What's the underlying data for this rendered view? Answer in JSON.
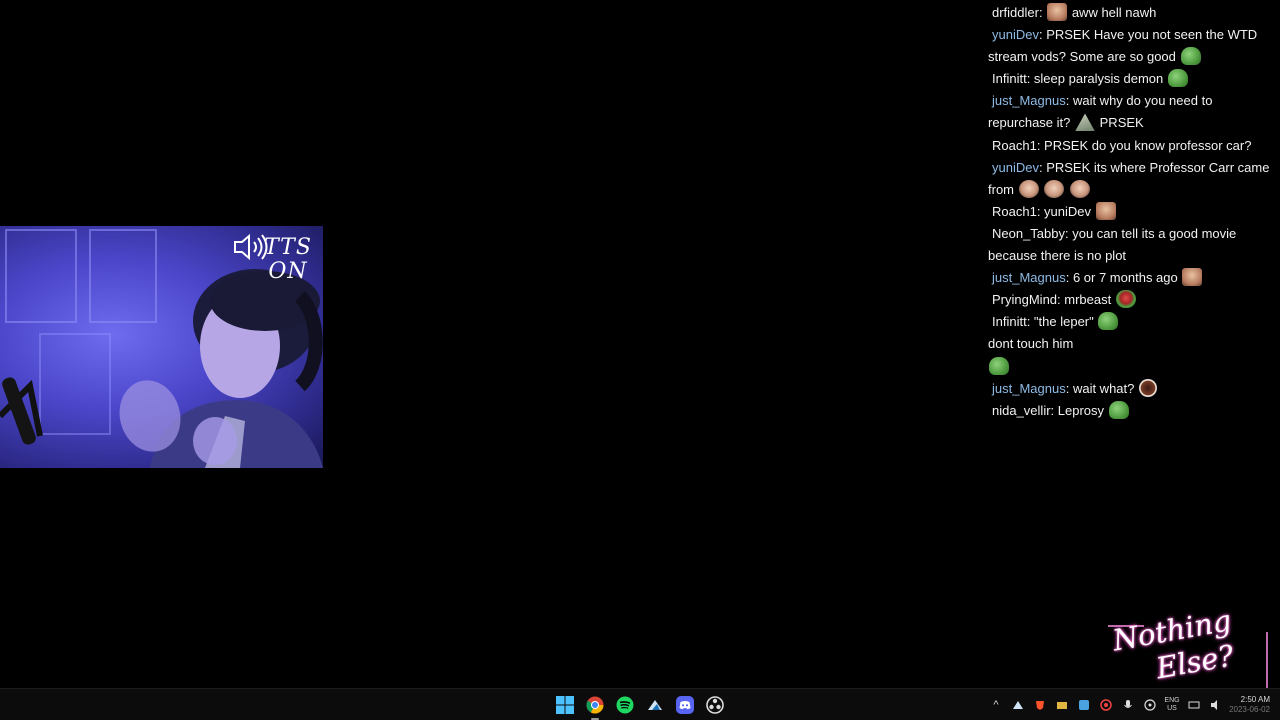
{
  "overlay": {
    "tts_line1": "TTS",
    "tts_line2": "ON",
    "logo_line1": "Nothing",
    "logo_line2": "Else?"
  },
  "chat": {
    "messages": [
      {
        "user": "drfiddler",
        "text": "aww hell nawh"
      },
      {
        "user": "yuniDev",
        "text": "PRSEK Have you not seen the WTD stream vods? Some are so good"
      },
      {
        "user": "Infinitt",
        "text": "sleep paralysis demon"
      },
      {
        "user": "just_Magnus",
        "text": "wait why do you need to repurchase it?",
        "text2": "PRSEK"
      },
      {
        "user": "Roach1",
        "text": "PRSEK do you know professor car?"
      },
      {
        "user": "yuniDev",
        "text": "PRSEK its where Professor Carr came from"
      },
      {
        "user": "Roach1",
        "text": "yuniDev"
      },
      {
        "user": "Neon_Tabby",
        "text": "you can tell its a good movie because there is no plot"
      },
      {
        "user": "just_Magnus",
        "text": "6 or 7 months ago"
      },
      {
        "user": "PryingMind",
        "text": "mrbeast"
      },
      {
        "user": "Infinitt",
        "text": "\"the leper\""
      },
      {
        "user": "",
        "text": "dont touch him"
      },
      {
        "user": "just_Magnus",
        "text": "wait what?"
      },
      {
        "user": "nida_vellir",
        "text": "Leprosy"
      }
    ]
  },
  "taskbar": {
    "apps": [
      {
        "name": "Start",
        "icon": "windows-icon"
      },
      {
        "name": "Chrome",
        "icon": "chrome-icon"
      },
      {
        "name": "Spotify",
        "icon": "spotify-icon"
      },
      {
        "name": "Steam",
        "icon": "steam-icon"
      },
      {
        "name": "Discord",
        "icon": "discord-icon"
      },
      {
        "name": "OBS",
        "icon": "obs-icon"
      }
    ],
    "lang_top": "ENG",
    "lang_bottom": "US",
    "time": "2:50 AM",
    "date": "2023-06-02"
  },
  "colors": {
    "background": "#000000",
    "username_blue": "#8ebbe6",
    "text": "#f2f2f2",
    "logo_glow": "#ff4fd1"
  }
}
